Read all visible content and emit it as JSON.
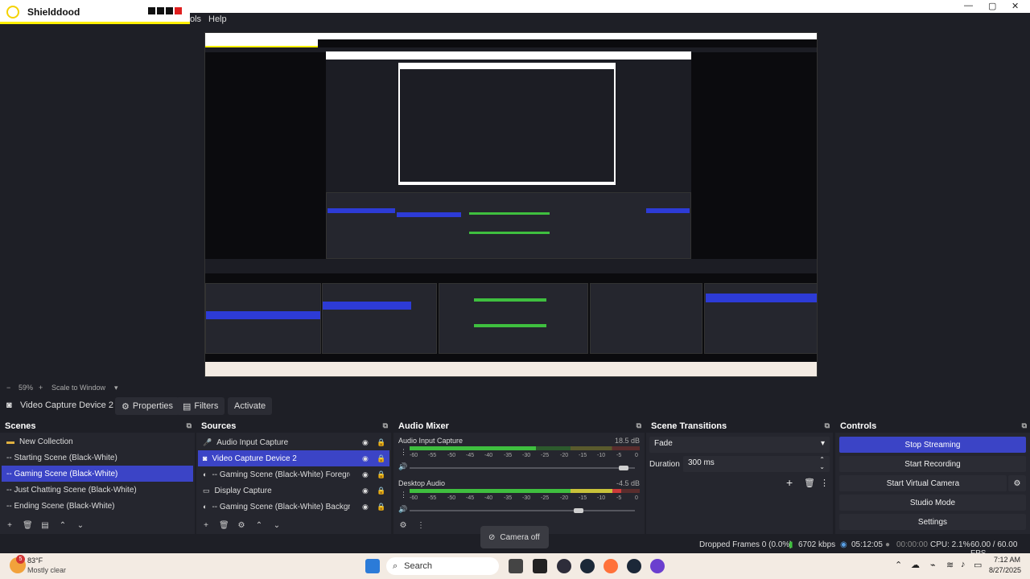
{
  "overlay": {
    "title": "Shielddood"
  },
  "menu": {
    "items": [
      "ols",
      "Help"
    ]
  },
  "window_controls": {
    "minimize": "—",
    "maximize": "▢",
    "close": "✕"
  },
  "zoom": {
    "minus": "−",
    "value": "59%",
    "plus": "+",
    "mode": "Scale to Window",
    "arrow": "▾"
  },
  "context": {
    "source": "Video Capture Device 2",
    "properties": "Properties",
    "filters": "Filters",
    "activate": "Activate"
  },
  "scenes": {
    "title": "Scenes",
    "items": [
      {
        "label": "New Collection",
        "selected": false
      },
      {
        "label": "-- Starting Scene (Black-White)",
        "selected": false
      },
      {
        "label": "-- Gaming Scene (Black-White)",
        "selected": true
      },
      {
        "label": "-- Just Chatting Scene (Black-White)",
        "selected": false
      },
      {
        "label": "-- Ending Scene (Black-White)",
        "selected": false
      }
    ]
  },
  "sources": {
    "title": "Sources",
    "items": [
      {
        "label": "Audio Input Capture",
        "icon": "mic-icon",
        "selected": false
      },
      {
        "label": "Video Capture Device 2",
        "icon": "camera-icon",
        "selected": true
      },
      {
        "label": "-- Gaming Scene (Black-White)  Foreground Br",
        "icon": "globe-icon",
        "selected": false
      },
      {
        "label": "Display Capture",
        "icon": "monitor-icon",
        "selected": false
      },
      {
        "label": "-- Gaming Scene (Black-White)  Background Br",
        "icon": "globe-icon",
        "selected": false
      }
    ]
  },
  "mixer": {
    "title": "Audio Mixer",
    "channels": [
      {
        "name": "Audio Input Capture",
        "db": "18.5 dB",
        "level": 0.55,
        "volume": 0.97
      },
      {
        "name": "Desktop Audio",
        "db": "-4.5 dB",
        "level": 0.92,
        "volume": 0.76
      }
    ],
    "scale": [
      "-60",
      "-55",
      "-50",
      "-45",
      "-40",
      "-35",
      "-30",
      "-25",
      "-20",
      "-15",
      "-10",
      "-5",
      "0"
    ]
  },
  "transitions": {
    "title": "Scene Transitions",
    "type": "Fade",
    "duration_label": "Duration",
    "duration_value": "300 ms"
  },
  "controls": {
    "title": "Controls",
    "stop_streaming": "Stop Streaming",
    "start_recording": "Start Recording",
    "start_virtual_camera": "Start Virtual Camera",
    "studio_mode": "Studio Mode",
    "settings": "Settings"
  },
  "status": {
    "dropped_frames": "Dropped Frames 0 (0.0%)",
    "bitrate": "6702 kbps",
    "stream_time": "05:12:05",
    "record_time": "00:00:00",
    "cpu": "CPU: 2.1%",
    "fps": "60.00 / 60.00 FPS"
  },
  "toast": {
    "label": "Camera off"
  },
  "taskbar": {
    "weather_temp": "83°F",
    "weather_desc": "Mostly clear",
    "badge": "5",
    "search": "Search",
    "time": "7:12 AM",
    "date": "8/27/2025"
  },
  "colors": {
    "accent": "#3b44c6",
    "meter_green": "#3fbf3f",
    "meter_yellow": "#c8c23a",
    "meter_red": "#cc3a3a"
  }
}
